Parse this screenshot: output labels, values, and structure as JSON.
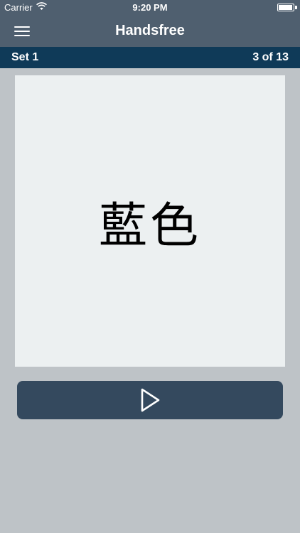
{
  "status_bar": {
    "carrier": "Carrier",
    "time": "9:20 PM",
    "battery_level": 0.95
  },
  "nav": {
    "title": "Handsfree",
    "menu_icon": "hamburger-menu-icon"
  },
  "set_bar": {
    "name": "Set 1",
    "count": "3 of 13"
  },
  "card": {
    "word": "藍色"
  },
  "controls": {
    "play_icon": "play-icon"
  },
  "colors": {
    "nav_background": "#4f5f6f",
    "set_bar_background": "#0f3a58",
    "card_background": "#ecf0f1",
    "button_background": "#34495e",
    "page_background": "#bec3c7"
  }
}
